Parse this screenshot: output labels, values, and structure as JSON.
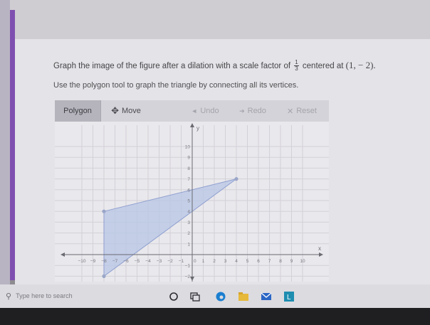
{
  "question": {
    "text_before": "Graph the image of the figure after a dilation with a scale factor of",
    "fraction_num": "1",
    "fraction_den": "3",
    "text_after": "centered at",
    "center": "(1,  − 2)."
  },
  "instruction": "Use the polygon tool to graph the triangle by connecting all its vertices.",
  "toolbar": {
    "polygon": "Polygon",
    "move": "Move",
    "undo": "Undo",
    "redo": "Redo",
    "reset": "Reset"
  },
  "graph": {
    "x_label": "x",
    "y_label": "y",
    "x_range": [
      -10,
      10
    ],
    "y_range": [
      -2,
      10
    ],
    "x_tick_labels": [
      "−10",
      "−9",
      "−8",
      "−7",
      "−6",
      "−5",
      "−4",
      "−3",
      "−2",
      "−1",
      "1",
      "2",
      "3",
      "4",
      "5",
      "6",
      "7",
      "8",
      "9",
      "10"
    ],
    "y_tick_labels": [
      "10",
      "9",
      "8",
      "7",
      "6",
      "5",
      "4",
      "3",
      "2",
      "1",
      "−1",
      "−2"
    ],
    "origin_label": "0",
    "triangle": [
      [
        -8,
        4
      ],
      [
        4,
        7
      ],
      [
        -8,
        -2
      ]
    ],
    "fill_color": "#b7c5e6",
    "stroke_color": "#8f9fcf"
  },
  "taskbar": {
    "search_placeholder": "Type here to search"
  },
  "colors": {
    "accent": "#7f4fb0",
    "edge_icon": "#1b7fd0",
    "word_icon": "#1e8db0"
  }
}
